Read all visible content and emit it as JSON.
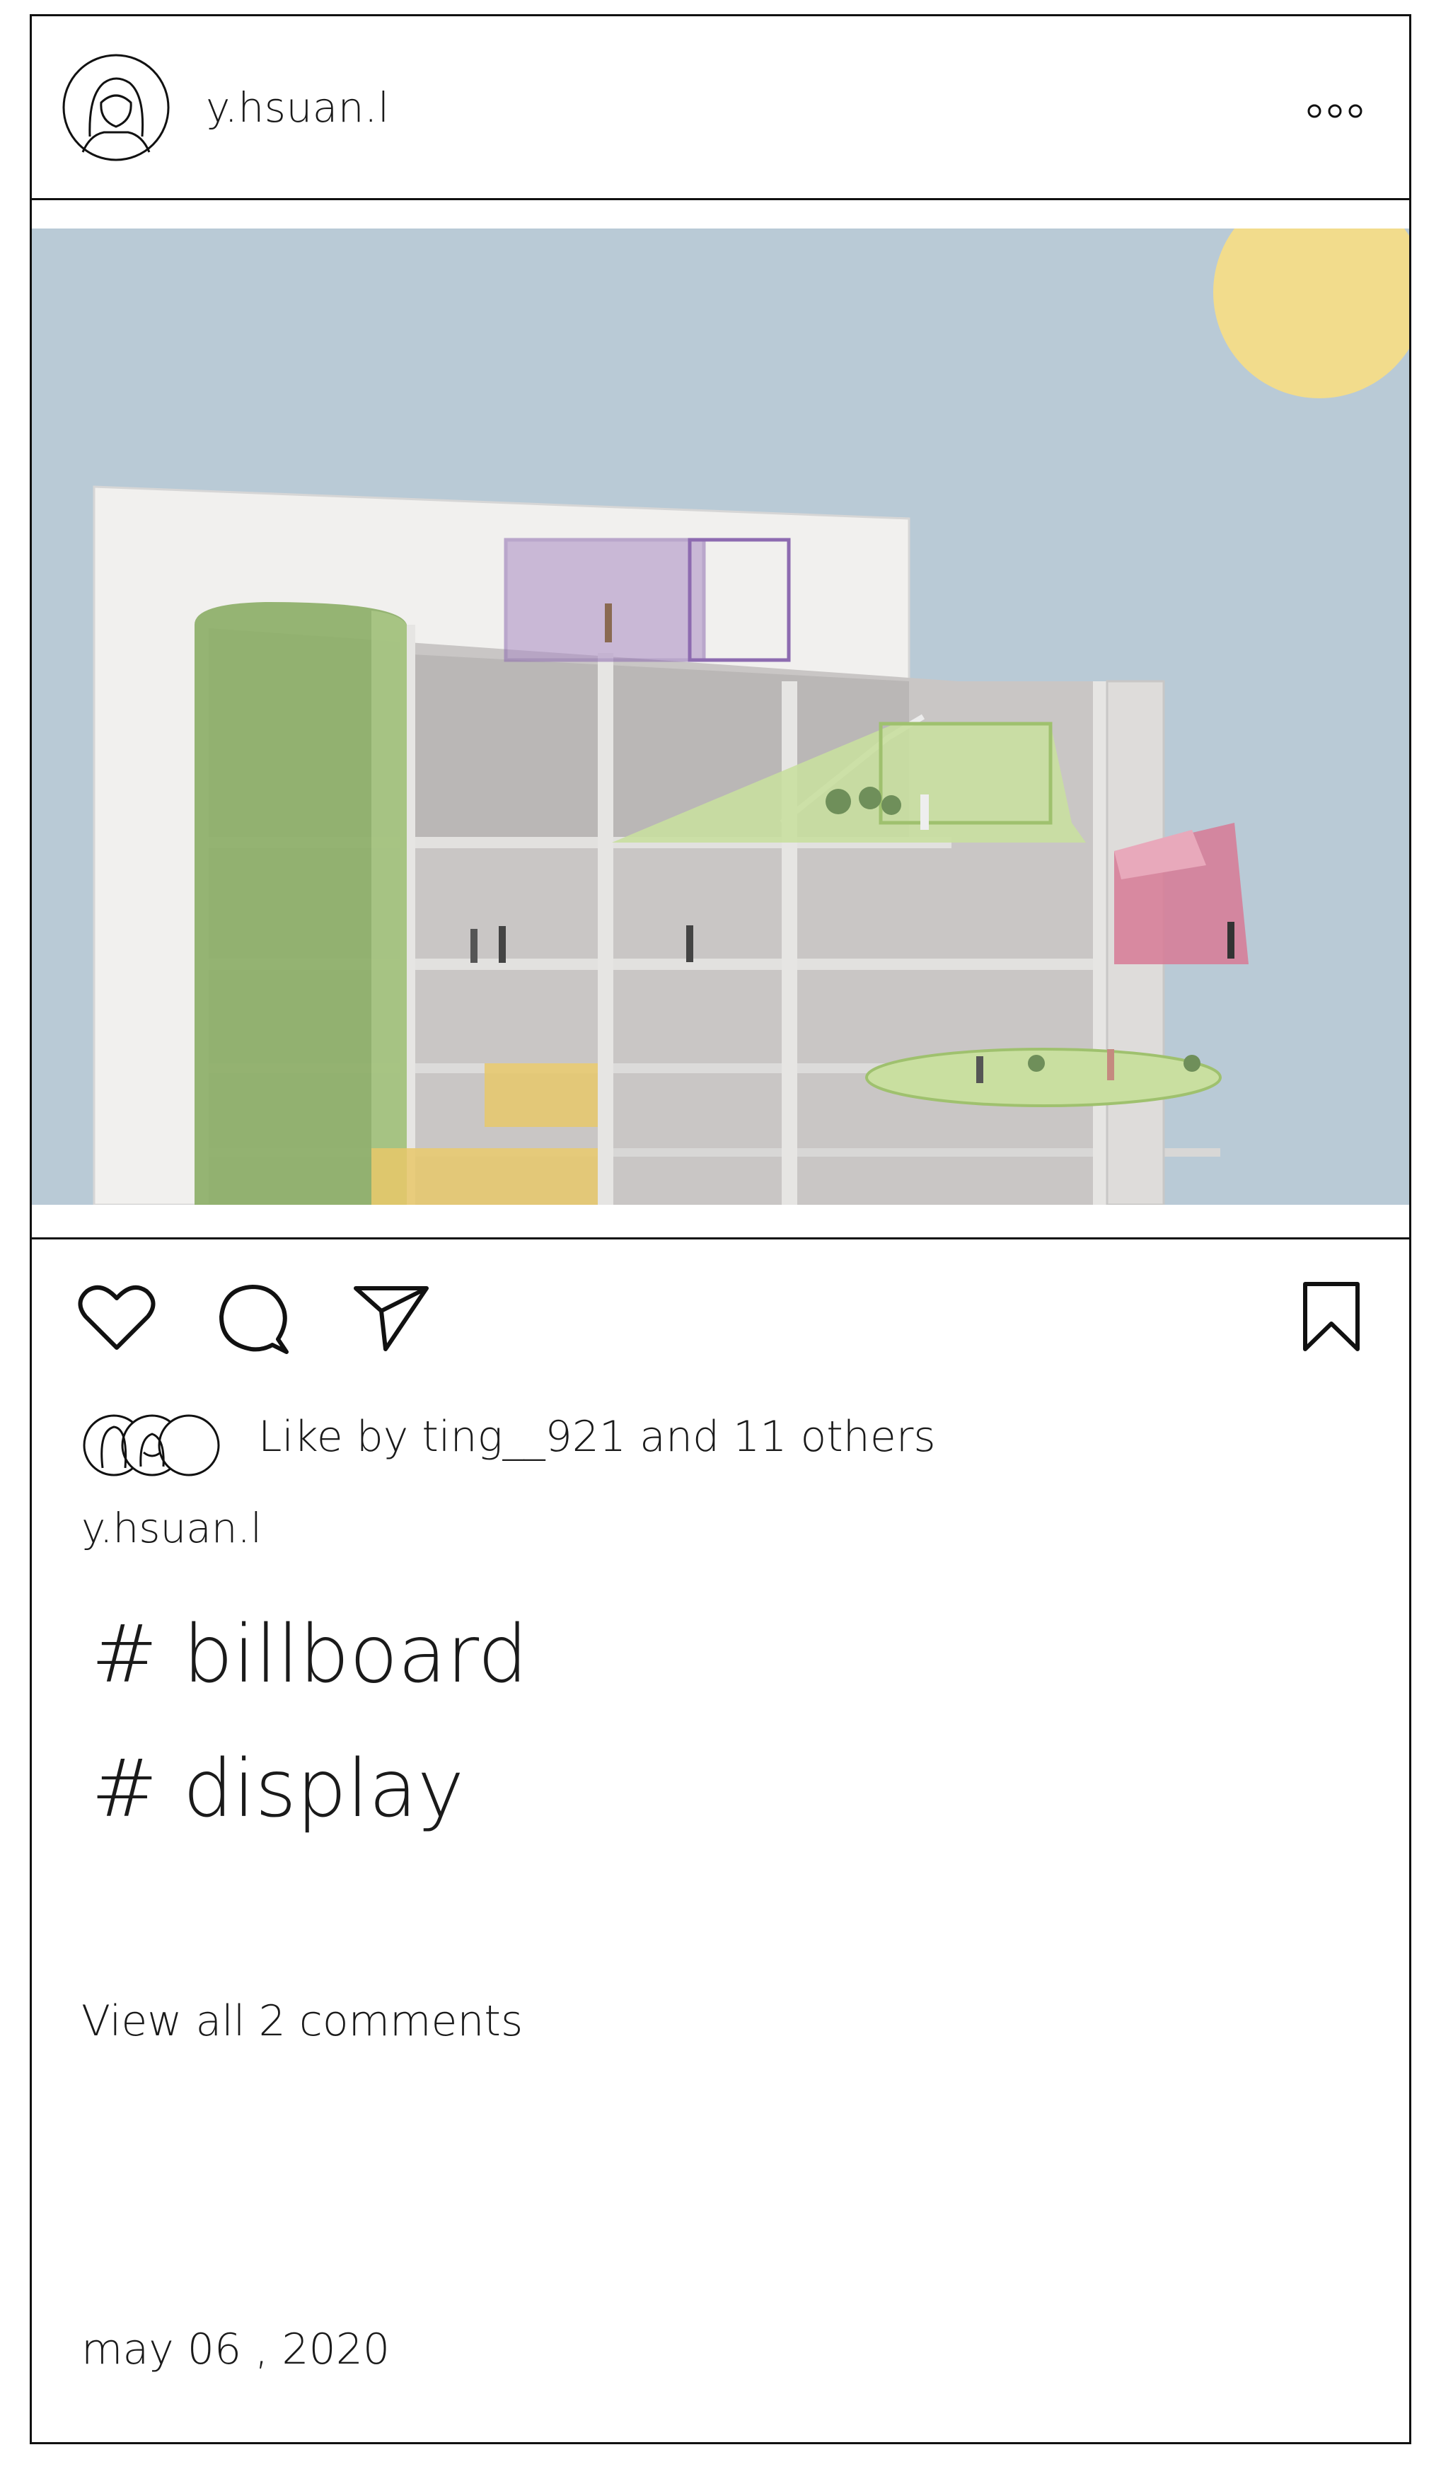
{
  "post": {
    "username": "y.hsuan.l",
    "like_text": "Like by ting__921 and 11 others",
    "caption_user": "y.hsuan.l",
    "hashtags": [
      "# billboard",
      "# display"
    ],
    "view_comments": "View all 2 comments",
    "date": "may 06 , 2020"
  },
  "icons": {
    "avatar": "woman-avatar-icon",
    "more": "more-options-icon",
    "like": "heart-icon",
    "comment": "comment-bubble-icon",
    "share": "paper-plane-icon",
    "save": "bookmark-icon"
  },
  "colors": {
    "sky": "#b9cad6",
    "sun": "#f2dc8c",
    "green_volume": "#8fb06b",
    "purple_box": "#a98bc4",
    "pink_box": "#d77a95",
    "lime_deck": "#c9dfa0",
    "yellow_floor": "#e8c86a"
  }
}
